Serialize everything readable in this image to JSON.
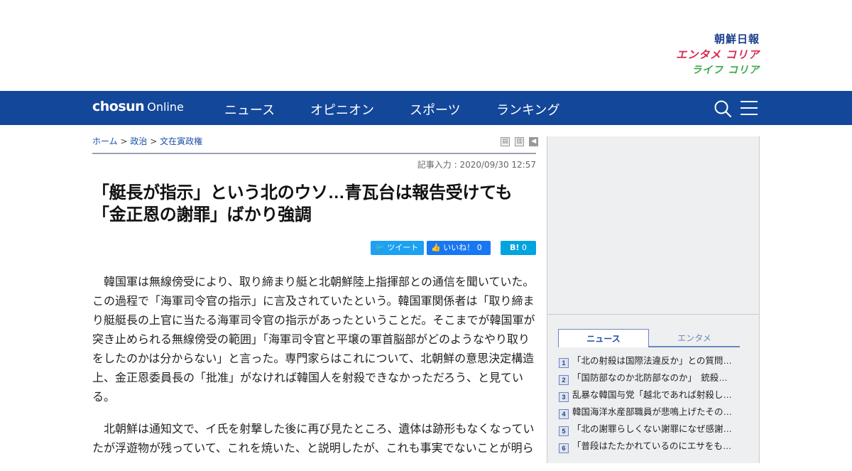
{
  "brands": {
    "chosun_ilbo": "朝鮮日報",
    "entame_korea": "エンタメ コリア",
    "life_korea": "ライフ コリア"
  },
  "nav": {
    "logo_bold": "chosun",
    "logo_light": "Online",
    "items": [
      "ニュース",
      "オピニオン",
      "スポーツ",
      "ランキング"
    ]
  },
  "breadcrumb": {
    "home": "ホーム",
    "sep": ">",
    "politics": "政治",
    "section": "文在寅政権"
  },
  "article": {
    "timestamp": "記事入力 : 2020/09/30 12:57",
    "title": "「艇長が指示」という北のウソ…青瓦台は報告受けても「金正恩の謝罪」ばかり強調",
    "paragraphs": [
      "韓国軍は無線傍受により、取り締まり艇と北朝鮮陸上指揮部との通信を聞いていた。この過程で「海軍司令官の指示」に言及されていたという。韓国軍関係者は「取り締まり艇艇長の上官に当たる海軍司令官の指示があったということだ。そこまでが韓国軍が突き止められる無線傍受の範囲」「海軍司令官と平壌の軍首脳部がどのようなやり取りをしたのかは分からない」と言った。専門家らはこれについて、北朝鮮の意思決定構造上、金正恩委員長の「批准」がなければ韓国人を射殺できなかっただろう、と見ている。",
      "北朝鮮は通知文で、イ氏を射撃した後に再び見たところ、遺体は跡形もなくなっていたが浮遊物が残っていて、これを焼いた、と説明したが、これも事実でないことが明ら"
    ]
  },
  "share": {
    "tweet": "ツイート",
    "like": "いいね！",
    "like_count": "0",
    "hatena": "B!",
    "hatena_count": "0"
  },
  "sidebar": {
    "tabs": [
      "ニュース",
      "エンタメ"
    ],
    "ranking": [
      {
        "rank": "1",
        "title": "「北の射殺は国際法違反か」との質問…"
      },
      {
        "rank": "2",
        "title": "「国防部なのか北防部なのか」　銃殺…"
      },
      {
        "rank": "3",
        "title": "乱暴な韓国与党「越北であれば射殺し…"
      },
      {
        "rank": "4",
        "title": "韓国海洋水産部職員が悲鳴上げたその…"
      },
      {
        "rank": "5",
        "title": "「北の謝罪らしくない謝罪になぜ感謝…"
      },
      {
        "rank": "6",
        "title": "「普段はたたかれているのにエサをも…"
      }
    ]
  }
}
